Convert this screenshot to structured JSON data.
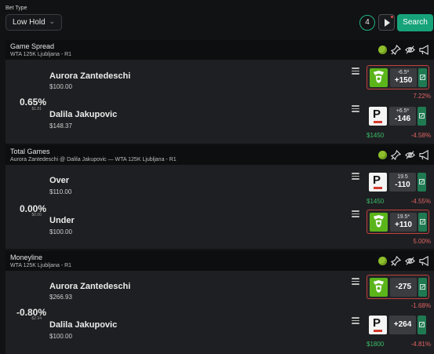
{
  "filter": {
    "bet_type_label": "Bet Type",
    "bet_type_value": "Low Hold",
    "count": "4",
    "search_label": "Search"
  },
  "colors": {
    "accent": "#16a37a",
    "negative": "#e06464",
    "positive": "#3bbf6a",
    "highlight": "#c0413c"
  },
  "sections": [
    {
      "title": "Game Spread",
      "subtitle": "WTA 125K Ljubljana - R1",
      "hold": "0.65%",
      "hold_sub": "$1.81",
      "rows": [
        {
          "name": "Aurora Zantedeschi",
          "stake": "$100.00",
          "book": "draftkings-icon",
          "line": "-6.5*",
          "odds": "+150",
          "ev": "7.22%",
          "highlight": true,
          "book_stake": ""
        },
        {
          "name": "Dalila Jakupovic",
          "stake": "$148.37",
          "book": "pointsbet-icon",
          "line": "+6.5*",
          "odds": "-146",
          "ev": "-4.58%",
          "highlight": false,
          "book_stake": "$1450"
        }
      ]
    },
    {
      "title": "Total Games",
      "subtitle": "Aurora Zantedeschi @ Dalila Jakupovic — WTA 125K Ljubljana - R1",
      "hold": "0.00%",
      "hold_sub": "$0.00",
      "rows": [
        {
          "name": "Over",
          "stake": "$110.00",
          "book": "pointsbet-icon",
          "line": "19.5",
          "odds": "-110",
          "ev": "-4.55%",
          "highlight": false,
          "book_stake": "$1450"
        },
        {
          "name": "Under",
          "stake": "$100.00",
          "book": "draftkings-icon",
          "line": "19.5*",
          "odds": "+110",
          "ev": "5.00%",
          "highlight": true,
          "book_stake": ""
        }
      ]
    },
    {
      "title": "Moneyline",
      "subtitle": "WTA 125K Ljubljana - R1",
      "hold": "-0.80%",
      "hold_sub": "-$2.94",
      "rows": [
        {
          "name": "Aurora Zantedeschi",
          "stake": "$266.93",
          "book": "draftkings-icon",
          "line": "",
          "odds": "-275",
          "ev": "-1.68%",
          "highlight": true,
          "book_stake": ""
        },
        {
          "name": "Dalila Jakupovic",
          "stake": "$100.00",
          "book": "pointsbet-icon",
          "line": "",
          "odds": "+264",
          "ev": "-4.81%",
          "highlight": false,
          "book_stake": "$1800"
        }
      ]
    }
  ]
}
